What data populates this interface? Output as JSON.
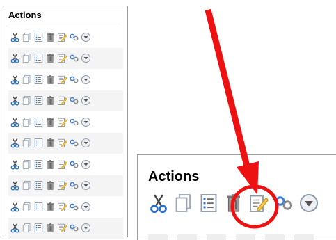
{
  "panel": {
    "title": "Actions",
    "rows": [
      {
        "icons": [
          "cut-icon",
          "copy-icon",
          "list-icon",
          "delete-icon",
          "edit-icon",
          "link-icon",
          "more-icon"
        ]
      },
      {
        "icons": [
          "cut-icon",
          "copy-icon",
          "list-icon",
          "delete-icon",
          "edit-icon",
          "link-icon",
          "more-icon"
        ]
      },
      {
        "icons": [
          "cut-icon",
          "copy-icon",
          "list-icon",
          "delete-icon",
          "edit-icon",
          "link-icon",
          "more-icon"
        ]
      },
      {
        "icons": [
          "cut-icon",
          "copy-icon",
          "list-icon",
          "delete-icon",
          "edit-icon",
          "link-icon",
          "more-icon"
        ]
      },
      {
        "icons": [
          "cut-icon",
          "copy-icon",
          "list-icon",
          "delete-icon",
          "edit-icon",
          "link-icon",
          "more-icon"
        ]
      },
      {
        "icons": [
          "cut-icon",
          "copy-icon",
          "list-icon",
          "delete-icon",
          "edit-icon",
          "link-icon",
          "more-icon"
        ]
      },
      {
        "icons": [
          "cut-icon",
          "copy-icon",
          "list-icon",
          "delete-icon",
          "edit-icon",
          "link-icon",
          "more-icon"
        ]
      },
      {
        "icons": [
          "cut-icon",
          "copy-icon",
          "list-icon",
          "delete-icon",
          "edit-icon",
          "link-icon",
          "more-icon"
        ]
      },
      {
        "icons": [
          "cut-icon",
          "copy-icon",
          "list-icon",
          "delete-icon",
          "edit-icon",
          "link-icon",
          "more-icon"
        ]
      },
      {
        "icons": [
          "cut-icon",
          "copy-icon",
          "list-icon",
          "delete-icon",
          "edit-icon",
          "link-icon",
          "more-icon"
        ]
      }
    ]
  },
  "zoom": {
    "title": "Actions",
    "icons": [
      "cut-icon",
      "copy-icon",
      "list-icon",
      "delete-icon",
      "edit-icon",
      "link-icon",
      "more-icon"
    ],
    "highlighted_icon": "edit-icon"
  },
  "annotation": {
    "color": "#ee1111"
  }
}
